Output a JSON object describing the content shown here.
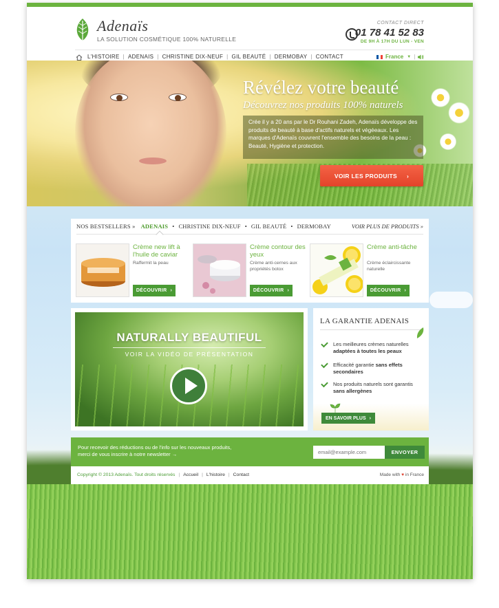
{
  "header": {
    "brand": "Adenaïs",
    "tagline": "LA SOLUTION COSMÉTIQUE 100% NATURELLE",
    "contact_label": "CONTACT DIRECT",
    "phone": "01 78 41 52 83",
    "hours": "DE 9H À 17H DU LUN - VEN"
  },
  "nav": {
    "items": [
      "L'HISTOIRE",
      "ADENAIS",
      "CHRISTINE DIX-NEUF",
      "GIL BEAUTÉ",
      "DERMOBAY",
      "CONTACT"
    ],
    "language": "France"
  },
  "hero": {
    "title": "Révélez votre beauté",
    "subtitle": "Découvrez nos produits 100% naturels",
    "text": "Crée il y a 20 ans par le Dr Rouhani Zadeh, Adenaïs développe des produits de beauté à base d'actifs naturels et végéeaux. Les marques d'Adenaïs couvrent l'ensemble des besoins de la peau : Beauté, Hygiène et protection.",
    "button": "VOIR LES PRODUITS"
  },
  "bestsellers": {
    "label": "NOS BESTSELLERS »",
    "tabs": [
      "ADENAIS",
      "CHRISTINE DIX-NEUF",
      "GIL BEAUTÉ",
      "DERMOBAY"
    ],
    "more": "VOIR PLUS DE PRODUITS »",
    "products": [
      {
        "title": "Crème new lift à l'huile de caviar",
        "desc": "Raffermit la peau",
        "button": "DÉCOUVRIR"
      },
      {
        "title": "Crème contour des yeux",
        "desc": "Crème anti-cernes aux propriétés botox",
        "button": "DÉCOUVRIR"
      },
      {
        "title": "Crème anti-tâche",
        "desc": "Crème éclaircissante naturelle",
        "button": "DÉCOUVRIR"
      }
    ]
  },
  "video": {
    "title": "NATURALLY BEAUTIFUL",
    "subtitle": "VOIR LA VIDÉO DE PRÉSENTATION"
  },
  "guarantee": {
    "title": "LA GARANTIE ADENAIS",
    "items": [
      {
        "text": "Les meilleures crèmes naturelles",
        "bold": "adaptées à toutes les peaux"
      },
      {
        "text": "Efficacité garantie",
        "bold": "sans effets secondaires"
      },
      {
        "text": "Nos produits naturels sont garantis",
        "bold": "sans allergènes"
      }
    ],
    "button": "EN SAVOIR PLUS"
  },
  "newsletter": {
    "text_line1": "Pour recevoir des réductions ou de l'info sur les nouveaux produits,",
    "text_line2": "merci de vous inscrire à notre newsletter →",
    "placeholder": "email@example.com",
    "button": "ENVOYER"
  },
  "footer": {
    "copyright": "Copyright © 2013 Adenaïs. Tout droits réservés",
    "links": [
      "Accueil",
      "L'histoire",
      "Contact"
    ],
    "made_with_prefix": "Made with",
    "made_with_suffix": "in France"
  }
}
